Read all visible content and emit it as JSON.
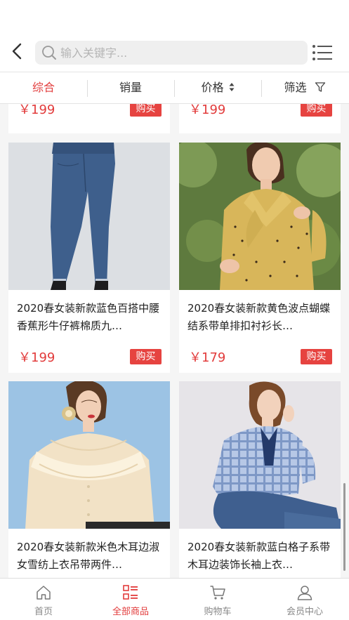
{
  "search": {
    "placeholder": "输入关键字..."
  },
  "sort_tabs": [
    {
      "label": "综合",
      "active": true
    },
    {
      "label": "销量",
      "active": false
    },
    {
      "label": "价格",
      "active": false
    },
    {
      "label": "筛选",
      "active": false
    }
  ],
  "buy_label": "购买",
  "partial_row": [
    {
      "price": "￥199"
    },
    {
      "price": "￥199"
    }
  ],
  "products": [
    {
      "title": "2020春女装新款蓝色百搭中腰香蕉形牛仔裤棉质九…",
      "price": "￥199"
    },
    {
      "title": "2020春女装新款黄色波点蝴蝶结系带单排扣衬衫长…",
      "price": "￥179"
    },
    {
      "title": "2020春女装新款米色木耳边淑女雪纺上衣吊带两件…",
      "price": ""
    },
    {
      "title": "2020春女装新款蓝白格子系带木耳边装饰长袖上衣…",
      "price": ""
    }
  ],
  "tabbar": [
    {
      "label": "首页",
      "icon": "home-icon",
      "active": false
    },
    {
      "label": "全部商品",
      "icon": "category-list-icon",
      "active": true
    },
    {
      "label": "购物车",
      "icon": "cart-icon",
      "active": false
    },
    {
      "label": "会员中心",
      "icon": "user-icon",
      "active": false
    }
  ],
  "colors": {
    "accent": "#e23c3c",
    "buy_button": "#e64340"
  }
}
